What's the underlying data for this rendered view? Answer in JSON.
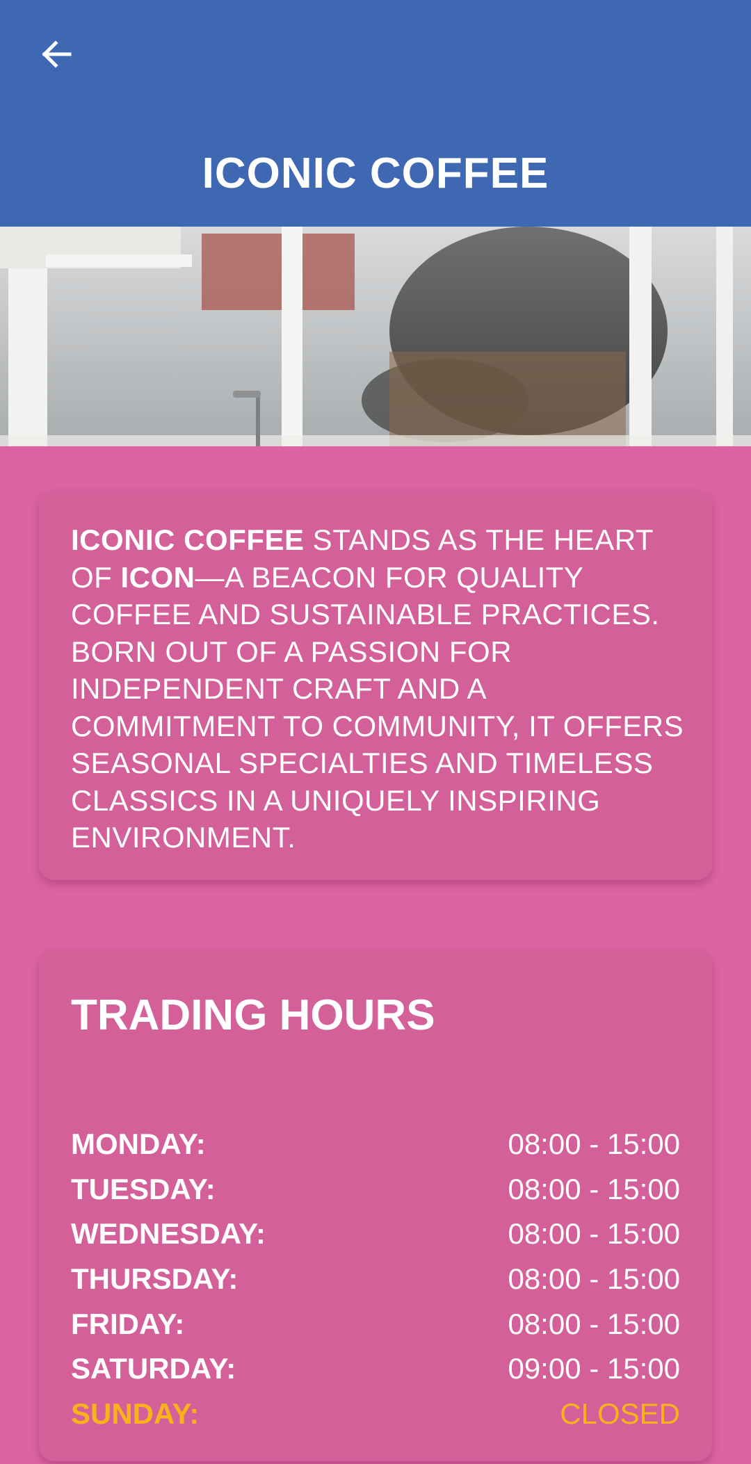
{
  "header": {
    "title": "ICONIC COFFEE",
    "back_icon": "arrow-left-icon"
  },
  "colors": {
    "header_bg": "#3f68b3",
    "page_bg": "#dc64a3",
    "card_bg": "#d36099",
    "closed_accent": "#f7b21c"
  },
  "intro": {
    "brand_bold": "ICONIC COFFEE",
    "text_1": " STANDS AS THE HEART OF ",
    "icon_bold": "ICON",
    "text_2": "—A BEACON FOR QUALITY COFFEE AND SUSTAINABLE PRACTICES. BORN OUT OF A PASSION FOR INDEPENDENT CRAFT AND A COMMITMENT TO COMMUNITY, IT OFFERS SEASONAL SPECIALTIES AND TIMELESS CLASSICS IN A UNIQUELY INSPIRING ENVIRONMENT."
  },
  "hours": {
    "title": "TRADING HOURS",
    "rows": [
      {
        "day": "MONDAY:",
        "time": "08:00 - 15:00"
      },
      {
        "day": "TUESDAY:",
        "time": "08:00 - 15:00"
      },
      {
        "day": "WEDNESDAY:",
        "time": "08:00 - 15:00"
      },
      {
        "day": "THURSDAY:",
        "time": "08:00 - 15:00"
      },
      {
        "day": "FRIDAY:",
        "time": "08:00 - 15:00"
      },
      {
        "day": "SATURDAY:",
        "time": "09:00 - 15:00"
      },
      {
        "day": "SUNDAY:",
        "time": "CLOSED"
      }
    ]
  }
}
